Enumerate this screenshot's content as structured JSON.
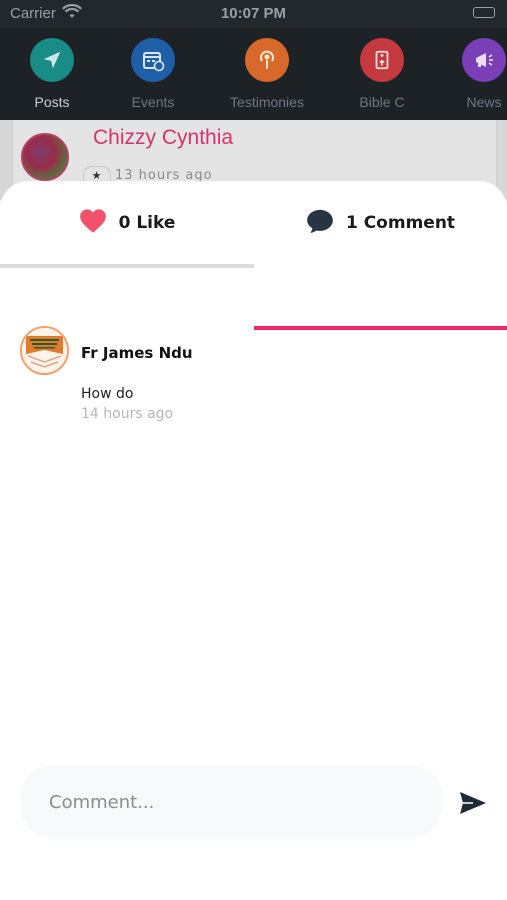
{
  "status_bar": {
    "carrier": "Carrier",
    "time": "10:07 PM"
  },
  "nav": {
    "items": [
      {
        "label": "Posts",
        "icon": "paper-plane-icon",
        "color": "#1a8c87",
        "active": true
      },
      {
        "label": "Events",
        "icon": "calendar-icon",
        "color": "#1f5fa8"
      },
      {
        "label": "Testimonies",
        "icon": "podcast-icon",
        "color": "#d8692a"
      },
      {
        "label": "Bible C",
        "icon": "bible-icon",
        "color": "#c43a3f"
      },
      {
        "label": "News",
        "icon": "megaphone-icon",
        "color": "#7a3fb6"
      }
    ]
  },
  "post": {
    "author": "Chizzy Cynthia",
    "time": "13 hours ago",
    "badge": "★"
  },
  "sheet": {
    "tabs": {
      "like": {
        "label": "0 Like",
        "icon": "heart-icon",
        "color": "#f2506b"
      },
      "comment": {
        "label": "1 Comment",
        "icon": "comment-bubble-icon",
        "color": "#263444"
      }
    },
    "active_tab": "comment",
    "accent": "#ee2566",
    "comments": [
      {
        "author": "Fr James Ndu",
        "text": "How do",
        "time": "14 hours ago"
      }
    ],
    "input": {
      "placeholder": "Comment...",
      "value": ""
    }
  }
}
